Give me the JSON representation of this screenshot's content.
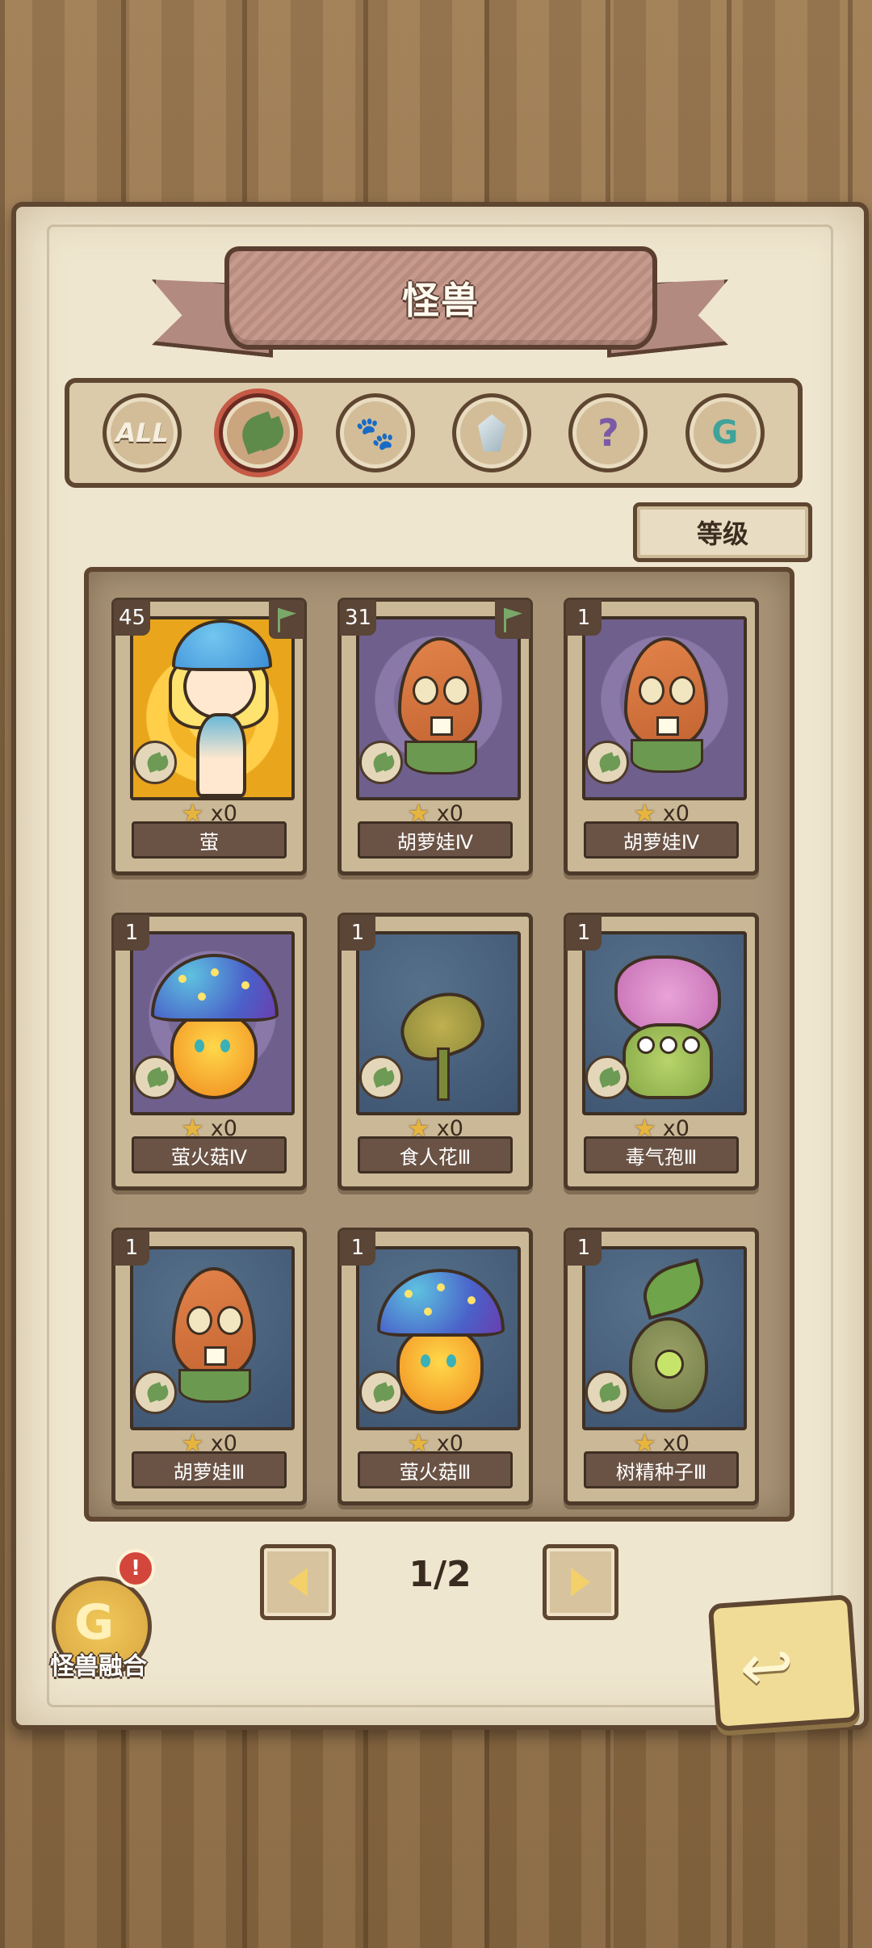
{
  "title": "怪兽",
  "filters": [
    {
      "label": "ALL",
      "icon": "all-text-icon",
      "active": false
    },
    {
      "label": "",
      "icon": "leaf-icon",
      "active": true
    },
    {
      "label": "",
      "icon": "paw-icon",
      "active": false
    },
    {
      "label": "",
      "icon": "crystal-icon",
      "active": false
    },
    {
      "label": "",
      "icon": "question-icon",
      "active": false
    },
    {
      "label": "",
      "icon": "ring-icon",
      "active": false
    }
  ],
  "sort_label": "等级",
  "cards": [
    {
      "level": "45",
      "count": "x0",
      "name": "萤",
      "flag": true,
      "creature": "mushroom-girl",
      "bg": "gold"
    },
    {
      "level": "31",
      "count": "x0",
      "name": "胡萝娃Ⅳ",
      "flag": true,
      "creature": "carrot",
      "bg": "purple"
    },
    {
      "level": "1",
      "count": "x0",
      "name": "胡萝娃Ⅳ",
      "flag": false,
      "creature": "carrot",
      "bg": "purple"
    },
    {
      "level": "1",
      "count": "x0",
      "name": "萤火菇Ⅳ",
      "flag": false,
      "creature": "glow-mushroom",
      "bg": "purple"
    },
    {
      "level": "1",
      "count": "x0",
      "name": "食人花Ⅲ",
      "flag": false,
      "creature": "flytrap",
      "bg": "blue"
    },
    {
      "level": "1",
      "count": "x0",
      "name": "毒气孢Ⅲ",
      "flag": false,
      "creature": "spore",
      "bg": "blue"
    },
    {
      "level": "1",
      "count": "x0",
      "name": "胡萝娃Ⅲ",
      "flag": false,
      "creature": "carrot",
      "bg": "blue"
    },
    {
      "level": "1",
      "count": "x0",
      "name": "萤火菇Ⅲ",
      "flag": false,
      "creature": "glow-mushroom",
      "bg": "blue"
    },
    {
      "level": "1",
      "count": "x0",
      "name": "树精种子Ⅲ",
      "flag": false,
      "creature": "tree-seed",
      "bg": "blue"
    }
  ],
  "pagination": {
    "current": "1/2"
  },
  "fusion": {
    "label": "怪兽融合",
    "badge": "!"
  },
  "colors": {
    "paper": "#efe6cf",
    "frame": "#5e4630",
    "ribbon": "#c79a8e",
    "accent_active": "#c65a46"
  }
}
